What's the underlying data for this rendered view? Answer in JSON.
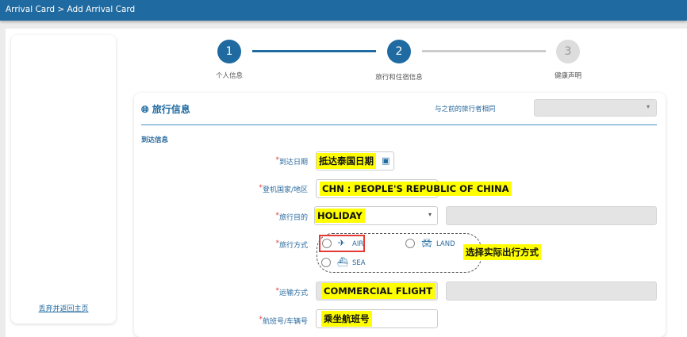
{
  "header": {
    "breadcrumb": "Arrival Card > Add Arrival Card"
  },
  "sidebar": {
    "back_link": "丢弃并返回主页"
  },
  "steps": [
    {
      "num": "1",
      "label": "个人信息"
    },
    {
      "num": "2",
      "label": "旅行和住宿信息"
    },
    {
      "num": "3",
      "label": "健康声明"
    }
  ],
  "section": {
    "title": "旅行信息",
    "same_as_label": "与之前的旅行者相同",
    "subtitle": "到达信息"
  },
  "form": {
    "arrival_date": {
      "label": "到达日期",
      "value": "抵达泰国日期"
    },
    "boarding_country": {
      "label": "登机国家/地区",
      "value": "CHN : PEOPLE'S REPUBLIC OF CHINA"
    },
    "purpose": {
      "label": "旅行目的",
      "value": "HOLIDAY"
    },
    "travel_mode": {
      "label": "旅行方式",
      "options": [
        "AIR",
        "LAND",
        "SEA"
      ],
      "note": "选择实际出行方式"
    },
    "transport": {
      "label": "运输方式",
      "value": "COMMERCIAL FLIGHT"
    },
    "flight_no": {
      "label": "航班号/车辆号",
      "value": "乘坐航班号"
    }
  },
  "colors": {
    "primary": "#1f6aa0",
    "highlight": "#ffff00"
  }
}
